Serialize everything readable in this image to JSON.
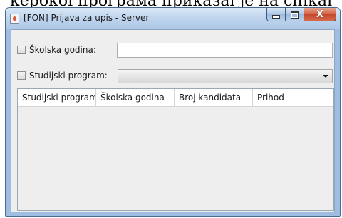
{
  "background": {
    "caption_fragment": "кербкої програма приказаі је на спікаі"
  },
  "window": {
    "title": "[FON] Prijava za upis - Server",
    "icon": "java-cup-icon",
    "buttons": {
      "minimize_icon": "minimize-icon",
      "maximize_icon": "maximize-icon",
      "close_glyph": "X"
    }
  },
  "form": {
    "school_year": {
      "checkbox_label": "Školska godina:",
      "checked": false,
      "value": ""
    },
    "study_program": {
      "checkbox_label": "Studijski program:",
      "checked": false,
      "selected": ""
    }
  },
  "table": {
    "columns": [
      "Studijski program",
      "Školska godina",
      "Broj kandidata",
      "Prihod"
    ],
    "rows": []
  },
  "colors": {
    "title_bar": "#bcd2ec",
    "close_button": "#c3452a",
    "client_bg": "#eeeeee"
  }
}
